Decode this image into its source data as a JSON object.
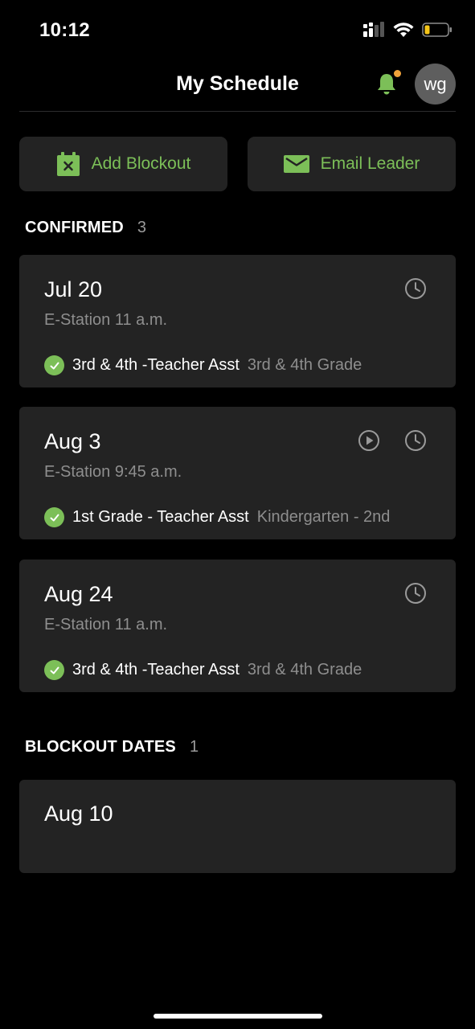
{
  "status_bar": {
    "time": "10:12"
  },
  "header": {
    "title": "My Schedule",
    "avatar_initials": "wg",
    "notification_icon": "bell-icon"
  },
  "actions": {
    "add_blockout": {
      "label": "Add Blockout",
      "icon": "calendar-x-icon"
    },
    "email_leader": {
      "label": "Email Leader",
      "icon": "envelope-icon"
    }
  },
  "confirmed": {
    "title": "CONFIRMED",
    "count": "3",
    "items": [
      {
        "date": "Jul 20",
        "subtitle": "E-Station 11 a.m.",
        "role": "3rd & 4th -Teacher Asst",
        "team": "3rd & 4th Grade",
        "icons": [
          "clock-icon"
        ]
      },
      {
        "date": "Aug 3",
        "subtitle": "E-Station 9:45 a.m.",
        "role": "1st Grade - Teacher Asst",
        "team": "Kindergarten - 2nd",
        "icons": [
          "play-icon",
          "clock-icon"
        ]
      },
      {
        "date": "Aug 24",
        "subtitle": "E-Station 11 a.m.",
        "role": "3rd & 4th -Teacher Asst",
        "team": "3rd & 4th Grade",
        "icons": [
          "clock-icon"
        ]
      }
    ]
  },
  "blockout": {
    "title": "BLOCKOUT DATES",
    "count": "1",
    "items": [
      {
        "date": "Aug 10"
      }
    ]
  },
  "colors": {
    "accent_green": "#7cbf58",
    "notification_dot": "#f0a23a",
    "card_bg": "#232323",
    "background": "#000000",
    "muted_text": "#8e8e8e"
  }
}
